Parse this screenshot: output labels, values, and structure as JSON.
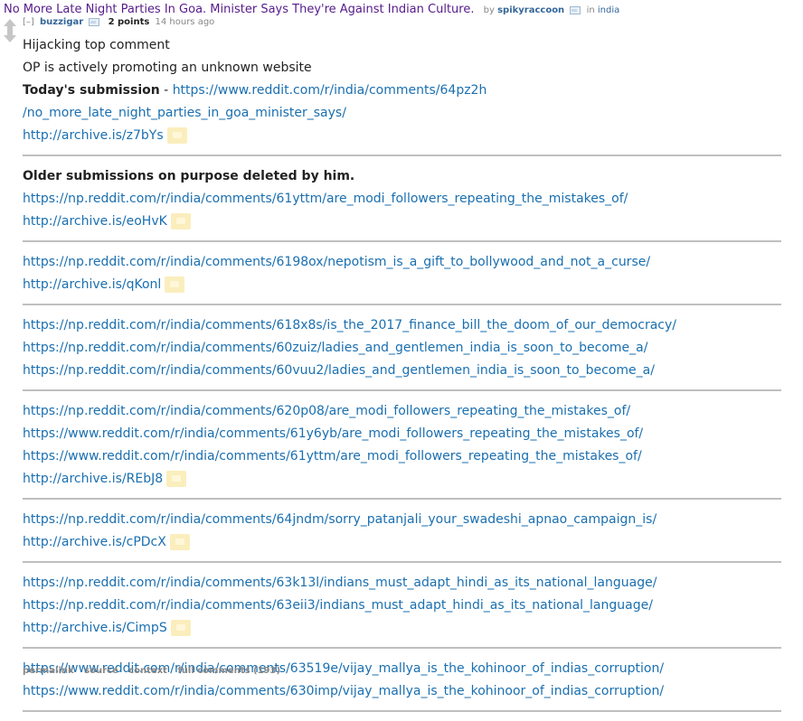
{
  "post": {
    "title": "No More Late Night Parties In Goa. Minister Says They're Against Indian Culture.",
    "by_label": "by",
    "author": "spikyraccoon",
    "in_label": "in",
    "subreddit": "india"
  },
  "comment": {
    "expand": "[–]",
    "author": "buzzigar",
    "score": "2 points",
    "time": "14 hours ago",
    "line1": "Hijacking top comment",
    "line2": "OP is actively promoting an unknown website",
    "today_label": "Today's submission",
    "today_sep": " - ",
    "today_link_1": "https://www.reddit.com/r/india/comments/64pz2h",
    "today_link_2": "/no_more_late_night_parties_in_goa_minister_says/",
    "today_archive": "http://archive.is/z7bYs",
    "older_label": "Older submissions on purpose deleted by him.",
    "groups": [
      {
        "links": [
          "https://np.reddit.com/r/india/comments/61yttm/are_modi_followers_repeating_the_mistakes_of/"
        ],
        "archive": "http://archive.is/eoHvK"
      },
      {
        "links": [
          "https://np.reddit.com/r/india/comments/6198ox/nepotism_is_a_gift_to_bollywood_and_not_a_curse/"
        ],
        "archive": "http://archive.is/qKonl"
      },
      {
        "links": [
          "https://np.reddit.com/r/india/comments/618x8s/is_the_2017_finance_bill_the_doom_of_our_democracy/",
          "https://np.reddit.com/r/india/comments/60zuiz/ladies_and_gentlemen_india_is_soon_to_become_a/",
          "https://np.reddit.com/r/india/comments/60vuu2/ladies_and_gentlemen_india_is_soon_to_become_a/"
        ],
        "archive": ""
      },
      {
        "links": [
          "https://np.reddit.com/r/india/comments/620p08/are_modi_followers_repeating_the_mistakes_of/",
          "https://www.reddit.com/r/india/comments/61y6yb/are_modi_followers_repeating_the_mistakes_of/",
          "https://www.reddit.com/r/india/comments/61yttm/are_modi_followers_repeating_the_mistakes_of/"
        ],
        "archive": "http://archive.is/REbJ8"
      },
      {
        "links": [
          "https://np.reddit.com/r/india/comments/64jndm/sorry_patanjali_your_swadeshi_apnao_campaign_is/"
        ],
        "archive": "http://archive.is/cPDcX"
      },
      {
        "links": [
          "https://np.reddit.com/r/india/comments/63k13l/indians_must_adapt_hindi_as_its_national_language/",
          "https://np.reddit.com/r/india/comments/63eii3/indians_must_adapt_hindi_as_its_national_language/"
        ],
        "archive": "http://archive.is/CimpS"
      },
      {
        "links": [
          "https://www.reddit.com/r/india/comments/63519e/vijay_mallya_is_the_kohinoor_of_indias_corruption/",
          "https://www.reddit.com/r/india/comments/630imp/vijay_mallya_is_the_kohinoor_of_indias_corruption/"
        ],
        "archive": ""
      }
    ],
    "buttons": [
      "permalink",
      "source",
      "context",
      "full comments (193)"
    ]
  },
  "colors": {
    "link": "#1a6fb0",
    "title": "#551a8b",
    "author": "#336699",
    "muted": "#888888",
    "tag": "#fbeebd"
  },
  "icons": [
    "upvote-arrow-icon",
    "downvote-arrow-icon",
    "flair-icon",
    "archive-tag-icon"
  ]
}
